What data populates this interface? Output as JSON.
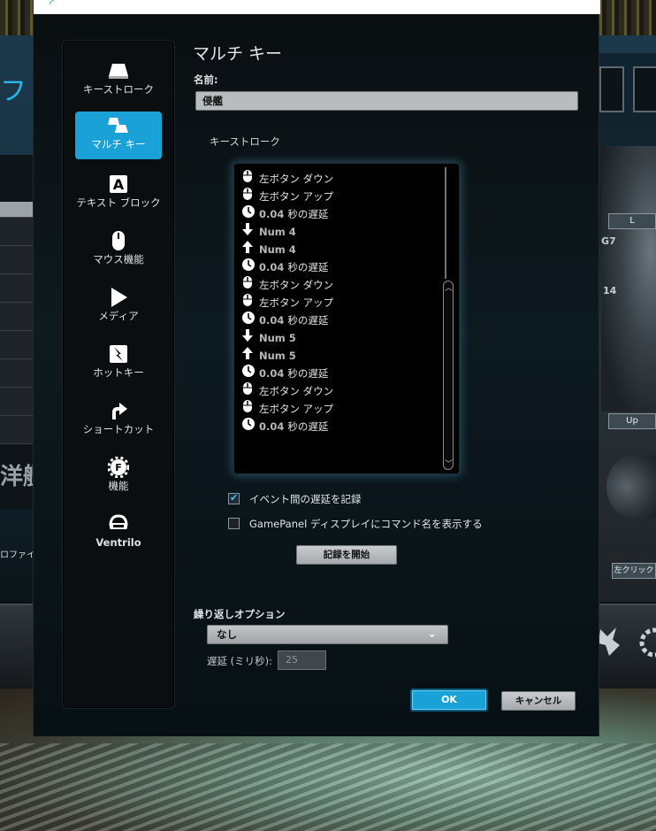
{
  "background": {
    "left_title": "フト",
    "left_big_text": "洋艦",
    "left_profile_text": "ロファイル",
    "right_labels": [
      "L",
      "G7",
      "14",
      "Up",
      "左クリック"
    ]
  },
  "sidebar": {
    "items": [
      {
        "label": "キーストローク",
        "icon": "keyboard-key-icon",
        "active": false
      },
      {
        "label": "マルチ キー",
        "icon": "multi-key-icon",
        "active": true
      },
      {
        "label": "テキスト ブロック",
        "icon": "text-block-icon",
        "active": false
      },
      {
        "label": "マウス機能",
        "icon": "mouse-icon",
        "active": false
      },
      {
        "label": "メディア",
        "icon": "play-icon",
        "active": false
      },
      {
        "label": "ホットキー",
        "icon": "hotkey-icon",
        "active": false
      },
      {
        "label": "ショートカット",
        "icon": "shortcut-arrow-icon",
        "active": false
      },
      {
        "label": "機能",
        "icon": "function-gear-icon",
        "active": false
      },
      {
        "label": "Ventrilo",
        "icon": "ventrilo-headset-icon",
        "active": false
      }
    ]
  },
  "main": {
    "title": "マルチ キー",
    "name_label": "名前:",
    "name_value": "侵艦",
    "keystroke_label": "キーストローク",
    "events": [
      {
        "icon": "mouse-button-icon",
        "text": "左ボタン ダウン"
      },
      {
        "icon": "mouse-button-icon",
        "text": "左ボタン アップ"
      },
      {
        "icon": "clock-icon",
        "num": "0.04",
        "text": "秒の遅延"
      },
      {
        "icon": "arrow-down-icon",
        "text": "Num 4"
      },
      {
        "icon": "arrow-up-icon",
        "text": "Num 4"
      },
      {
        "icon": "clock-icon",
        "num": "0.04",
        "text": "秒の遅延"
      },
      {
        "icon": "mouse-button-icon",
        "text": "左ボタン ダウン"
      },
      {
        "icon": "mouse-button-icon",
        "text": "左ボタン アップ"
      },
      {
        "icon": "clock-icon",
        "num": "0.04",
        "text": "秒の遅延"
      },
      {
        "icon": "arrow-down-icon",
        "text": "Num 5"
      },
      {
        "icon": "arrow-up-icon",
        "text": "Num 5"
      },
      {
        "icon": "clock-icon",
        "num": "0.04",
        "text": "秒の遅延"
      },
      {
        "icon": "mouse-button-icon",
        "text": "左ボタン ダウン"
      },
      {
        "icon": "mouse-button-icon",
        "text": "左ボタン アップ"
      },
      {
        "icon": "clock-icon",
        "num": "0.04",
        "text": "秒の遅延"
      }
    ],
    "record_delay_label": "イベント間の遅延を記録",
    "record_delay_checked": true,
    "gamepanel_label": "GamePanel ディスプレイにコマンド名を表示する",
    "gamepanel_checked": false,
    "record_button": "記録を開始",
    "repeat_label": "繰り返しオプション",
    "repeat_value": "なし",
    "delay_label": "遅延 (ミリ秒):",
    "delay_value": "25",
    "ok_label": "OK",
    "cancel_label": "キャンセル"
  },
  "colors": {
    "accent": "#1aa2d8",
    "dialog_bg": "#0b1418",
    "list_glow": "#5aaad2"
  }
}
